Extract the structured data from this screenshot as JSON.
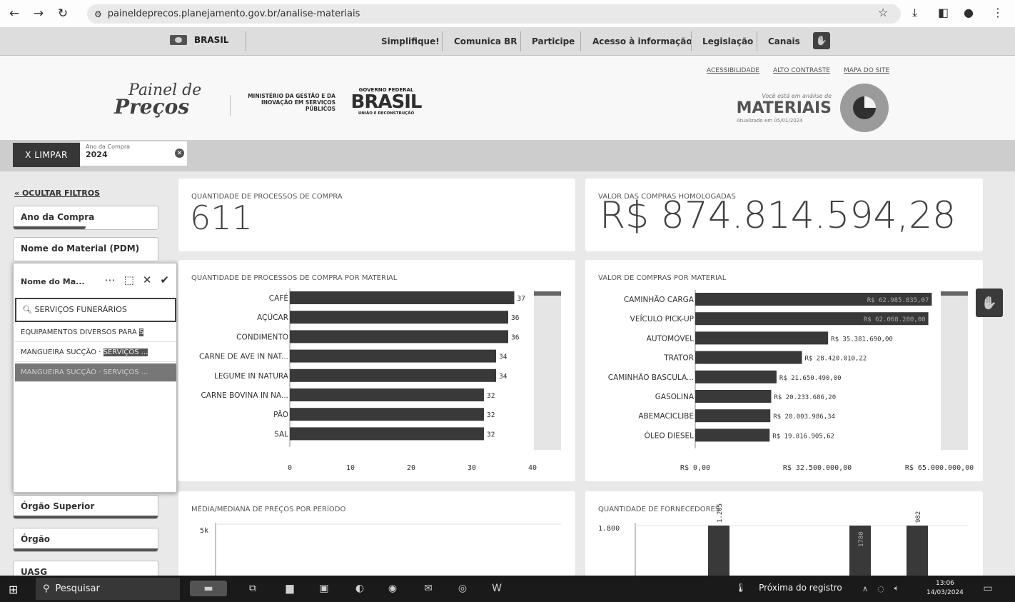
{
  "browser": {
    "url": "paineldeprecos.planejamento.gov.br/analise-materiais"
  },
  "govbar": {
    "brasil": "BRASIL",
    "links": [
      "Simplifique!",
      "Comunica BR",
      "Participe",
      "Acesso à informação",
      "Legislação",
      "Canais"
    ]
  },
  "header": {
    "acessibilidade": "ACESSIBILIDADE",
    "alto_contraste": "ALTO CONTRASTE",
    "mapa_site": "MAPA DO SITE",
    "logo_line1": "Painel de",
    "logo_line2": "Preços",
    "ministerio": "MINISTÉRIO DA GESTÃO E DA INOVAÇÃO EM SERVIÇOS PÚBLICOS",
    "gov_federal": "GOVERNO FEDERAL",
    "brasil_logo": "BRASIL",
    "uniao": "UNIÃO E RECONSTRUÇÃO",
    "analise_label": "Você está em análise de",
    "materiais": "MATERIAIS",
    "atualizado": "Atualizado em 05/01/2024"
  },
  "filterbar": {
    "limpar": "X  LIMPAR",
    "chip_label": "Ano da Compra",
    "chip_value": "2024"
  },
  "sidebar": {
    "ocultar": "OCULTAR FILTROS",
    "filters_top": [
      "Ano da Compra",
      "Nome do Material (PDM)"
    ],
    "filters_bottom": [
      "Órgão Superior",
      "Órgão",
      "UASG"
    ]
  },
  "popup": {
    "title": "Nome do Ma...",
    "search_value": "SERVIÇOS FUNERÁRIOS",
    "items": [
      {
        "text": "EQUIPAMENTOS DIVERSOS PARA ",
        "hl": "S"
      },
      {
        "text": "MANGUEIRA SUCÇÃO · ",
        "hl": "SERVIÇOS ..."
      },
      {
        "text": "MANGUEIRA SUCÇÃO · SERVIÇOS ...",
        "hl": ""
      }
    ]
  },
  "kpis": {
    "qtd_title": "QUANTIDADE DE PROCESSOS DE COMPRA",
    "qtd_value": "611",
    "valor_title": "VALOR DAS COMPRAS HOMOLOGADAS",
    "valor_value": "R$ 874.814.594,28"
  },
  "chart_titles": {
    "c1": "QUANTIDADE DE PROCESSOS DE COMPRA POR MATERIAL",
    "c2": "VALOR DE COMPRAS POR MATERIAL",
    "c3": "MÉDIA/MEDIANA DE PREÇOS POR PERÍODO",
    "c4": "QUANTIDADE DE FORNECEDORES"
  },
  "chart_data": [
    {
      "type": "bar",
      "orientation": "horizontal",
      "title": "QUANTIDADE DE PROCESSOS DE COMPRA POR MATERIAL",
      "categories": [
        "CAFÉ",
        "AÇÚCAR",
        "CONDIMENTO",
        "CARNE DE AVE IN NAT...",
        "LEGUME IN NATURA",
        "CARNE BOVINA IN NA...",
        "PÃO",
        "SAL"
      ],
      "values": [
        37,
        36,
        36,
        34,
        34,
        32,
        32,
        32
      ],
      "xlim": [
        0,
        40
      ],
      "xticks": [
        "0",
        "10",
        "20",
        "30",
        "40"
      ]
    },
    {
      "type": "bar",
      "orientation": "horizontal",
      "title": "VALOR DE COMPRAS POR MATERIAL",
      "categories": [
        "CAMINHÃO CARGA",
        "VEÍCULO PICK-UP",
        "AUTOMÓVEL",
        "TRATOR",
        "CAMINHÃO BASCULA...",
        "GASOLINA",
        "ABEMACICLIBE",
        "ÓLEO DIESEL"
      ],
      "values": [
        62985835.07,
        62068280.0,
        35381690.0,
        28420010.22,
        21650490.0,
        20233686.2,
        20003986.34,
        19816905.62
      ],
      "labels": [
        "R$ 62.985.835,07",
        "R$ 62.068.280,00",
        "R$ 35.381.690,00",
        "R$ 28.420.010,22",
        "R$ 21.650.490,00",
        "R$ 20.233.686,20",
        "R$ 20.003.986,34",
        "R$ 19.816.905,62"
      ],
      "xlim": [
        0,
        65000000
      ],
      "xticks": [
        "R$ 0,00",
        "R$ 32.500.000,00",
        "R$ 65.000.000,00"
      ]
    },
    {
      "type": "line",
      "title": "MÉDIA/MEDIANA DE PREÇOS POR PERÍODO",
      "yticks": [
        "5k"
      ]
    },
    {
      "type": "bar",
      "title": "QUANTIDADE DE FORNECEDORES",
      "values": [
        1205,
        1780,
        982
      ],
      "labels": [
        "1.205",
        "1780",
        "982"
      ],
      "yticks": [
        "1.800"
      ]
    }
  ],
  "taskbar": {
    "search": "Pesquisar",
    "notif": "Próxima do registro",
    "time": "13:06",
    "date": "14/03/2024"
  }
}
